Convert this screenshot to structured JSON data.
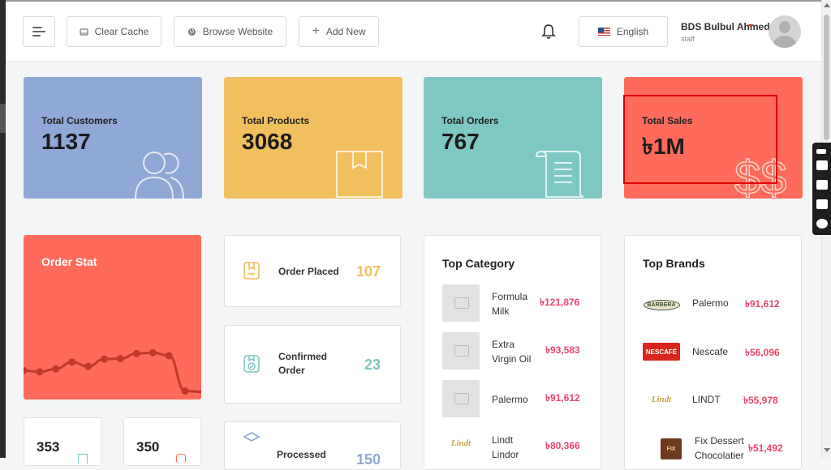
{
  "header": {
    "clear_cache": "Clear Cache",
    "browse_website": "Browse Website",
    "add_new": "Add New",
    "language": "English",
    "user_name": "BDS Bulbul Ahmed",
    "user_role": "staff"
  },
  "stats": [
    {
      "label": "Total Customers",
      "value": "1137",
      "color": "#8fa8d6"
    },
    {
      "label": "Total Products",
      "value": "3068",
      "color": "#f0bf5e"
    },
    {
      "label": "Total Orders",
      "value": "767",
      "color": "#7fc7c3"
    },
    {
      "label": "Total Sales",
      "value": "৳1M",
      "color": "#ff6b5b"
    }
  ],
  "order_stat": {
    "title": "Order Stat",
    "chart_data": {
      "type": "line",
      "values": [
        68,
        65,
        72,
        88,
        78,
        95,
        96,
        108,
        110,
        103,
        20,
        18
      ]
    }
  },
  "mini_stats": [
    "353",
    "350"
  ],
  "orders": [
    {
      "label": "Order Placed",
      "count": "107",
      "color": "#f0bf5e"
    },
    {
      "label_line1": "Confirmed",
      "label_line2": "Order",
      "count": "23",
      "color": "#7fc7c3"
    },
    {
      "label": "Processed",
      "count": "150",
      "color": "#8fa8d6"
    }
  ],
  "top_category": {
    "title": "Top Category",
    "items": [
      {
        "name": "Formula Milk",
        "price": "৳121,876"
      },
      {
        "name": "Extra Virgin Oil",
        "price": "৳93,583"
      },
      {
        "name": "Palermo",
        "price": "৳91,612"
      },
      {
        "name": "Lindt Lindor",
        "price": "৳80,366"
      }
    ]
  },
  "top_brands": {
    "title": "Top Brands",
    "items": [
      {
        "name": "Palermo",
        "price": "৳91,612",
        "logo": "BARBERA"
      },
      {
        "name": "Nescafe",
        "price": "৳56,096",
        "logo": "NESCAFÉ"
      },
      {
        "name": "LINDT",
        "price": "৳55,978",
        "logo": "Lindt"
      },
      {
        "name": "Fix Dessert Chocolatier",
        "price": "৳51,492",
        "logo": "FIX"
      }
    ]
  }
}
